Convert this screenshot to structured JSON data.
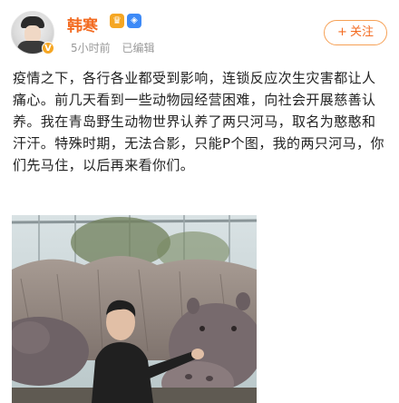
{
  "post": {
    "author": "韩寒",
    "time": "5小时前",
    "edited": "已编辑",
    "follow_label": "关注",
    "text": "疫情之下，各行各业都受到影响，连锁反应次生灾害都让人痛心。前几天看到一些动物园经营困难，向社会开展慈善认养。我在青岛野生动物世界认养了两只河马，取名为憨憨和汗汗。特殊时期，无法合影，只能P个图，我的两只河马，你们先马住，以后再来看你们。",
    "verified_badge": "V",
    "icons": [
      "avatar",
      "crown-icon",
      "shield-icon",
      "plus-icon"
    ]
  },
  "colors": {
    "username": "#f36b21",
    "meta": "#999999",
    "follow_border": "#f6a156",
    "text": "#222222"
  }
}
